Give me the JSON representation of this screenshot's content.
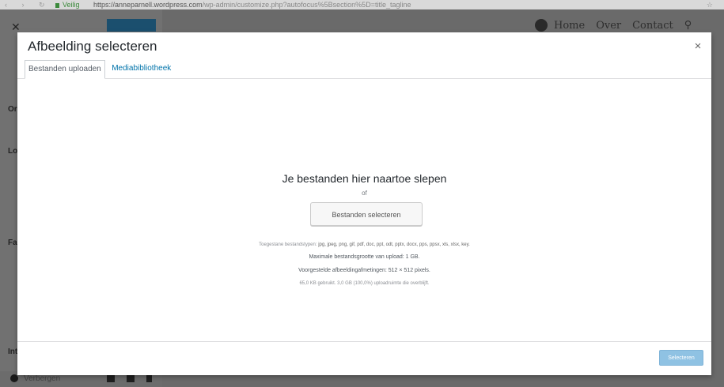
{
  "browser": {
    "secure_label": "Veilig",
    "url_host": "https://anneparnell.wordpress.com",
    "url_path": "/wp-admin/customize.php?autofocus%5Bsection%5D=title_tagline"
  },
  "background": {
    "nav_items": [
      "Home",
      "Over",
      "Contact"
    ],
    "bottom_label": "Verbergen",
    "side_letters": [
      "Or",
      "Lo",
      "Fa",
      "Int"
    ]
  },
  "modal": {
    "title": "Afbeelding selecteren",
    "close_glyph": "×",
    "tabs": [
      {
        "label": "Bestanden uploaden",
        "active": true
      },
      {
        "label": "Mediabibliotheek",
        "active": false
      }
    ],
    "uploader": {
      "drop_instructions": "Je bestanden hier naartoe slepen",
      "or": "of",
      "select_files_button": "Bestanden selecteren",
      "allowed_types_label": "Toegestane bestandstypen:",
      "allowed_types": "jpg, jpeg, png, gif, pdf, doc, ppt, odt, pptx, docx, pps, ppsx, xls, xlsx, key.",
      "max_size": "Maximale bestandsgrootte van upload: 1 GB.",
      "suggested_dimensions": "Voorgestelde afbeeldingafmetingen: 512 × 512 pixels.",
      "space_used": "65,0 KB gebruikt. 3,0 GB (100,0%) uploadruimte die overblijft."
    },
    "select_button": "Selecteren"
  },
  "colors": {
    "accent": "#0073aa",
    "button_primary_disabled": "#8fc2e3",
    "overlay": "#6b6b6b"
  }
}
